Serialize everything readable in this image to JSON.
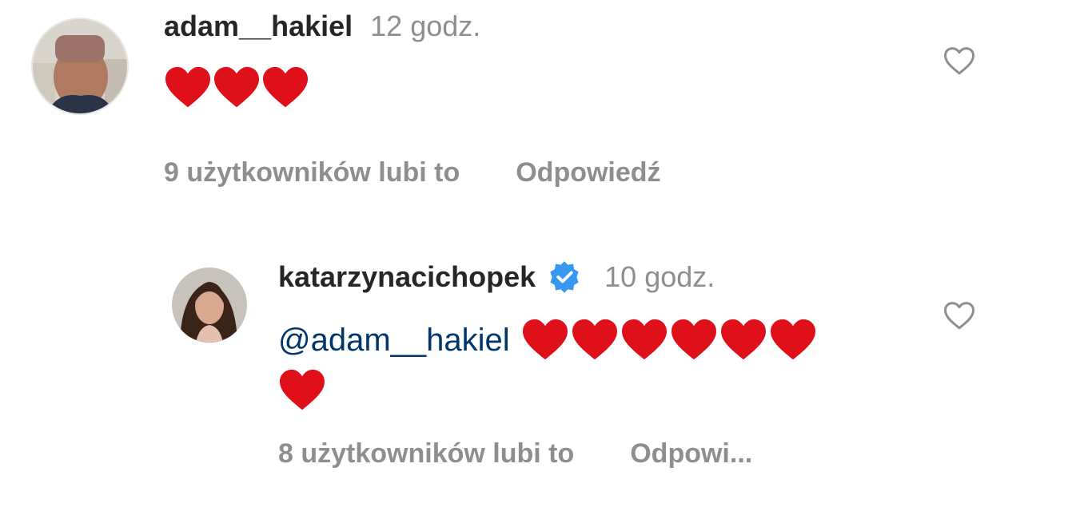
{
  "comments": [
    {
      "username": "adam__hakiel",
      "time": "12 godz.",
      "text": "",
      "emoji": [
        "red-heart",
        "red-heart",
        "red-heart"
      ],
      "likes": "9 użytkowników lubi to",
      "reply": "Odpowiedź",
      "verified": false
    },
    {
      "username": "katarzynacichopek",
      "time": "10 godz.",
      "text": "@adam__hakiel",
      "emoji": [
        "red-heart",
        "red-heart",
        "red-heart",
        "red-heart",
        "red-heart",
        "red-heart",
        "red-heart"
      ],
      "likes": "8 użytkowników lubi to",
      "reply": "Odpowi...",
      "verified": true
    }
  ],
  "colors": {
    "username": "#262626",
    "secondary": "#8e8e8e",
    "mention": "#00376b",
    "verified": "#3897f0",
    "heart": "#e0101a"
  },
  "icons": {
    "like": "heart-outline-icon",
    "verified": "verified-badge-icon"
  }
}
